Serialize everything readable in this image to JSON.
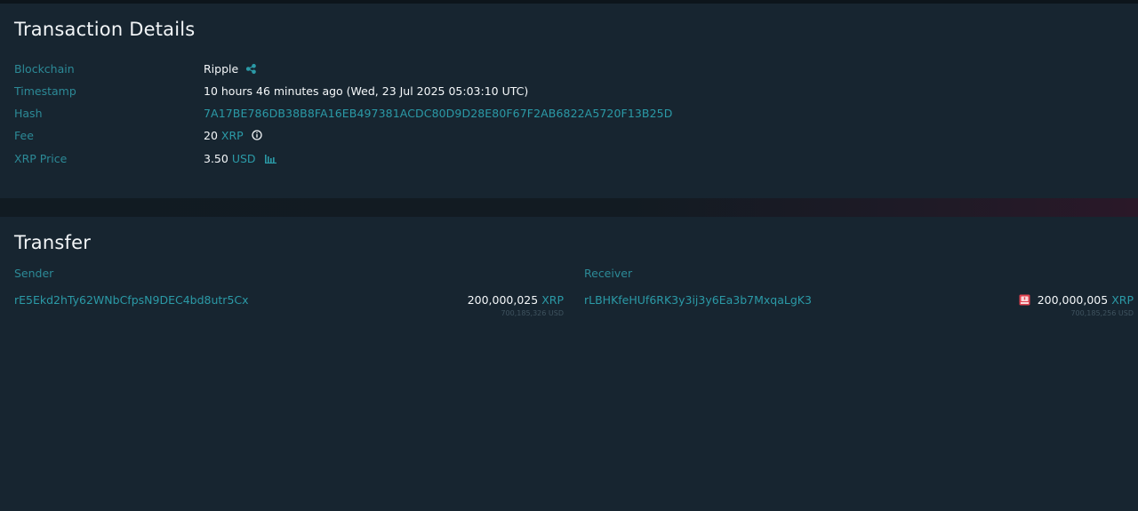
{
  "details": {
    "title": "Transaction Details",
    "rows": {
      "blockchain": {
        "label": "Blockchain",
        "value": "Ripple"
      },
      "timestamp": {
        "label": "Timestamp",
        "value": "10 hours 46 minutes ago (Wed, 23 Jul 2025 05:03:10 UTC)"
      },
      "hash": {
        "label": "Hash",
        "value": "7A17BE786DB38B8FA16EB497381ACDC80D9D28E80F67F2AB6822A5720F13B25D"
      },
      "fee": {
        "label": "Fee",
        "value": "20",
        "unit": "XRP"
      },
      "price": {
        "label": "XRP Price",
        "value": "3.50",
        "unit": "USD"
      }
    }
  },
  "transfer": {
    "title": "Transfer",
    "sender": {
      "label": "Sender",
      "address": "rE5Ekd2hTy62WNbCfpsN9DEC4bd8utr5Cx",
      "amount": "200,000,025",
      "unit": "XRP",
      "usd": "700,185,326 USD"
    },
    "receiver": {
      "label": "Receiver",
      "address": "rLBHKfeHUf6RK3y3ij3y6Ea3b7MxqaLgK3",
      "amount": "200,000,005",
      "unit": "XRP",
      "usd": "700,185,256 USD"
    }
  },
  "icons": {
    "ripple": "ripple-logo-icon",
    "info": "info-circle-icon",
    "chart": "bar-chart-icon",
    "alert": "alert-flag-icon"
  },
  "colors": {
    "accent": "#2b9aa7",
    "label": "#2c8a97",
    "background": "#172530",
    "alert": "#e0424f"
  }
}
